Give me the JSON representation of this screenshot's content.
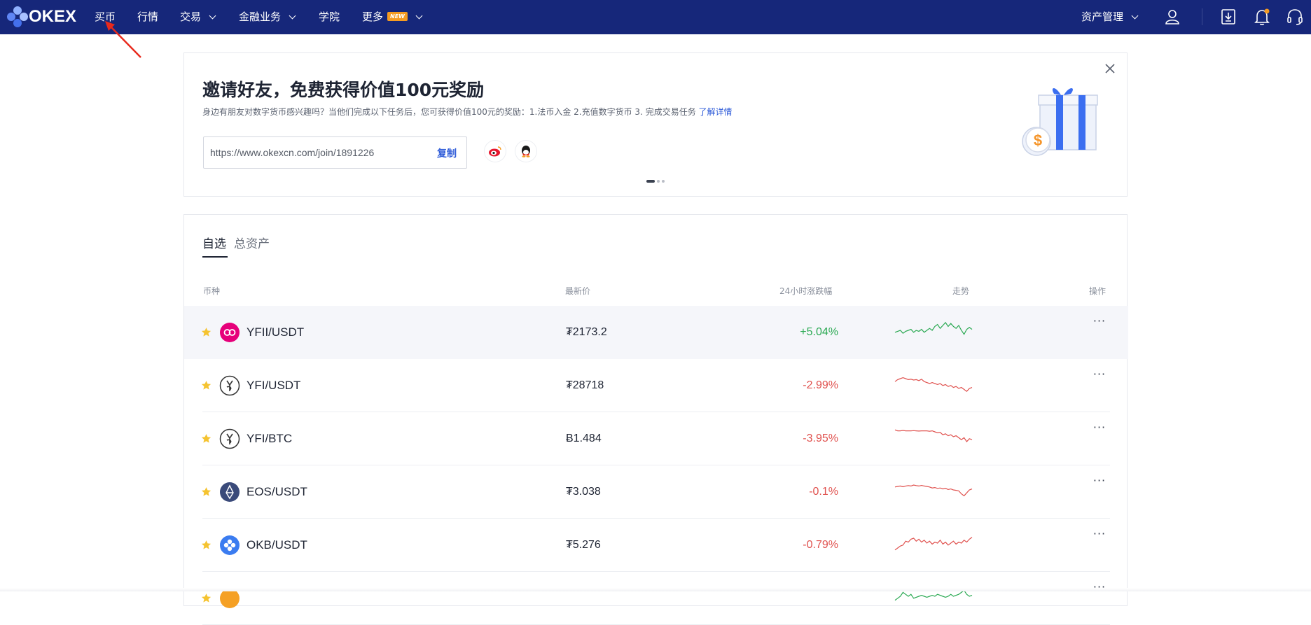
{
  "header": {
    "logo": "OKEX",
    "nav": [
      {
        "label": "买币",
        "has_chevron": false
      },
      {
        "label": "行情",
        "has_chevron": false
      },
      {
        "label": "交易",
        "has_chevron": true
      },
      {
        "label": "金融业务",
        "has_chevron": true
      },
      {
        "label": "学院",
        "has_chevron": false
      },
      {
        "label": "更多",
        "badge": "NEW",
        "has_chevron": true
      }
    ],
    "asset_menu": "资产管理",
    "icons": [
      "user-icon",
      "download-icon",
      "bell-icon",
      "headset-icon"
    ],
    "colors": {
      "bar": "#16277a",
      "badge": "#f59b22",
      "notification_dot": "#f59b22"
    }
  },
  "invite": {
    "title": "邀请好友，免费获得价值100元奖励",
    "description": "身边有朋友对数字货币感兴趣吗？当他们完成以下任务后，您可获得价值100元的奖励：1.法币入金 2.充值数字货币 3. 完成交易任务",
    "details_link": "了解详情",
    "invite_url": "https://www.okexcn.com/join/1891226",
    "copy_label": "复制",
    "share_icons": [
      "weibo-icon",
      "qq-icon"
    ],
    "carousel": {
      "count": 3,
      "active": 0
    }
  },
  "watchlist": {
    "tabs": [
      "自选",
      "总资产"
    ],
    "active_tab": 0,
    "columns": {
      "coin": "币种",
      "price": "最新价",
      "change": "24小时涨跌幅",
      "trend": "走势",
      "action": "操作"
    },
    "rows": [
      {
        "pair": "YFII/USDT",
        "price": "₮2173.2",
        "change": "+5.04%",
        "direction": "up",
        "icon": "yfii-icon",
        "icon_color": "#e6007a",
        "trend": [
          0.4,
          0.45,
          0.5,
          0.35,
          0.45,
          0.5,
          0.55,
          0.4,
          0.5,
          0.45,
          0.55,
          0.4,
          0.5,
          0.6,
          0.5,
          0.7,
          0.8,
          0.6,
          0.75,
          0.9,
          0.7,
          0.85,
          0.7,
          0.6,
          0.75,
          0.5,
          0.3,
          0.55,
          0.65,
          0.55
        ],
        "starred": true,
        "highlighted": true
      },
      {
        "pair": "YFI/USDT",
        "price": "₮28718",
        "change": "-2.99%",
        "direction": "down",
        "icon": "yfi-icon",
        "icon_color": "#333333",
        "trend": [
          0.6,
          0.7,
          0.75,
          0.8,
          0.75,
          0.7,
          0.72,
          0.68,
          0.7,
          0.65,
          0.72,
          0.6,
          0.55,
          0.5,
          0.55,
          0.5,
          0.45,
          0.5,
          0.4,
          0.45,
          0.35,
          0.4,
          0.3,
          0.35,
          0.25,
          0.3,
          0.2,
          0.1,
          0.25,
          0.3
        ],
        "starred": true
      },
      {
        "pair": "YFI/BTC",
        "price": "Ƀ1.484",
        "change": "-3.95%",
        "direction": "down",
        "icon": "yfi-icon",
        "icon_color": "#333333",
        "trend": [
          0.85,
          0.8,
          0.8,
          0.82,
          0.8,
          0.8,
          0.8,
          0.81,
          0.8,
          0.79,
          0.8,
          0.8,
          0.8,
          0.78,
          0.8,
          0.75,
          0.7,
          0.72,
          0.6,
          0.65,
          0.55,
          0.6,
          0.5,
          0.55,
          0.45,
          0.35,
          0.45,
          0.25,
          0.4,
          0.35
        ],
        "starred": true
      },
      {
        "pair": "EOS/USDT",
        "price": "₮3.038",
        "change": "-0.1%",
        "direction": "down",
        "icon": "eos-icon",
        "icon_color": "#3a4a7a",
        "trend": [
          0.65,
          0.68,
          0.7,
          0.66,
          0.7,
          0.72,
          0.7,
          0.75,
          0.72,
          0.7,
          0.73,
          0.7,
          0.68,
          0.65,
          0.6,
          0.62,
          0.58,
          0.6,
          0.55,
          0.58,
          0.52,
          0.55,
          0.5,
          0.48,
          0.45,
          0.3,
          0.2,
          0.35,
          0.5,
          0.55
        ],
        "starred": true
      },
      {
        "pair": "OKB/USDT",
        "price": "₮5.276",
        "change": "-0.79%",
        "direction": "down",
        "icon": "okb-icon",
        "icon_color": "#3b7cf0",
        "trend": [
          0.15,
          0.25,
          0.35,
          0.4,
          0.6,
          0.55,
          0.7,
          0.75,
          0.6,
          0.7,
          0.55,
          0.65,
          0.5,
          0.6,
          0.45,
          0.55,
          0.5,
          0.65,
          0.45,
          0.55,
          0.4,
          0.5,
          0.6,
          0.45,
          0.55,
          0.5,
          0.65,
          0.55,
          0.7,
          0.8
        ],
        "starred": true
      },
      {
        "pair": "",
        "price": "",
        "change": "",
        "direction": "up",
        "icon": "coin-icon",
        "icon_color": "#f5a024",
        "trend": [
          0.3,
          0.4,
          0.5,
          0.7,
          0.6,
          0.5,
          0.6,
          0.4,
          0.45,
          0.5,
          0.55,
          0.5,
          0.45,
          0.5,
          0.55,
          0.5,
          0.6,
          0.55,
          0.5,
          0.45,
          0.5,
          0.6,
          0.5,
          0.55,
          0.6,
          0.7,
          0.8,
          0.6,
          0.5,
          0.55
        ],
        "starred": true
      }
    ]
  }
}
